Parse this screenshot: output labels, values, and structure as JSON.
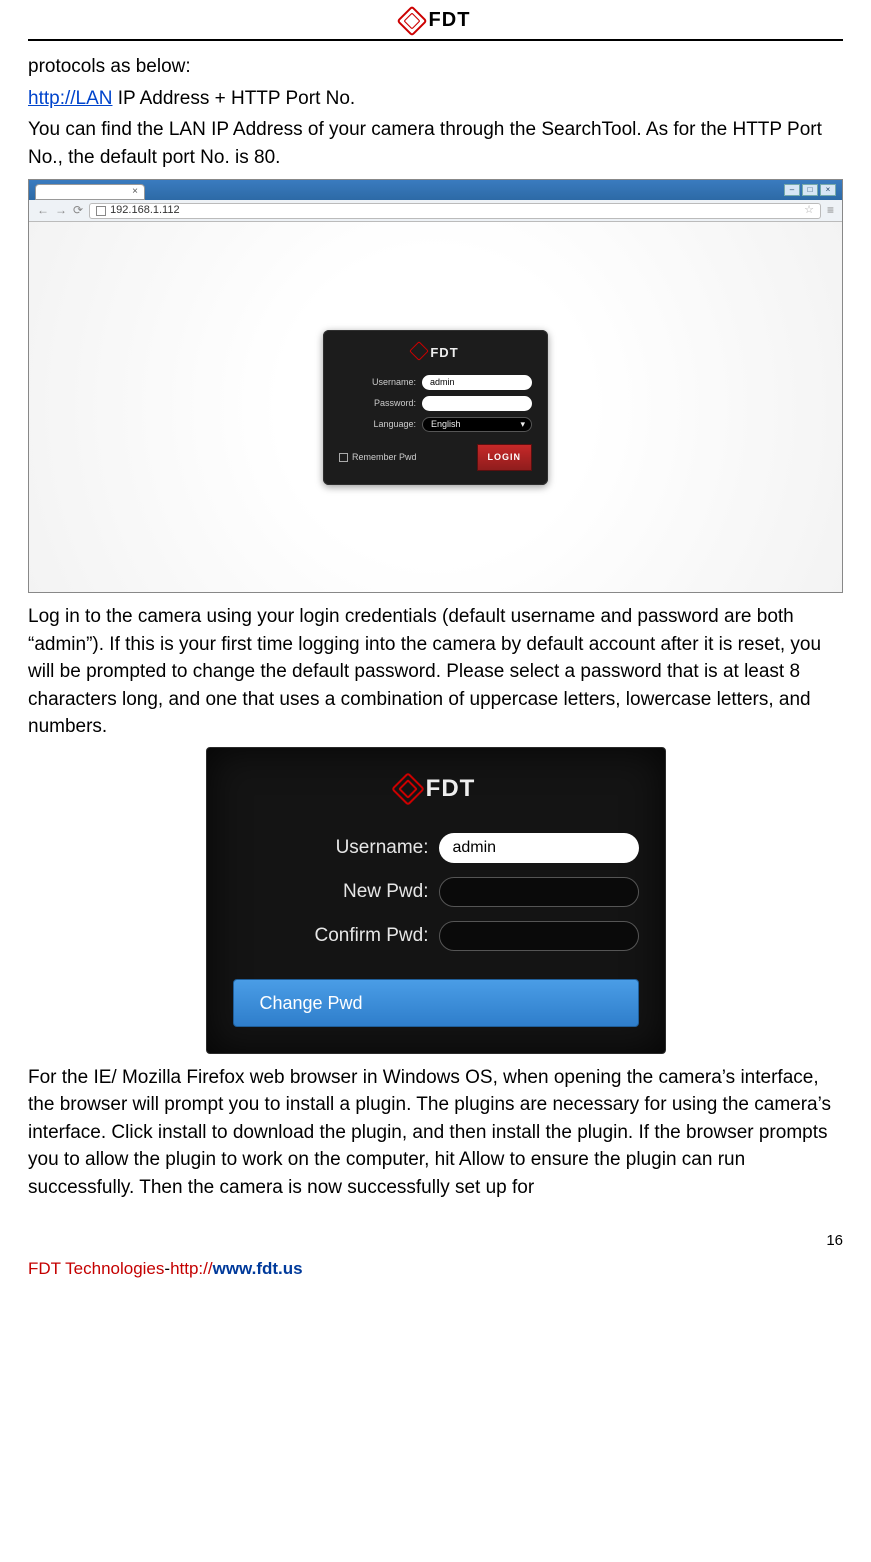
{
  "header": {
    "brand": "FDT"
  },
  "body": {
    "p1": "protocols as below:",
    "link1": "http://LAN",
    "p1b": " IP Address + HTTP Port No.",
    "p2": "You can find the LAN IP Address of your camera through the SearchTool. As for the HTTP Port No., the default port No. is 80.",
    "p3": "Log in to the camera using your login credentials (default username and password are both “admin”). If this is your first time logging into the camera by default account after it is reset, you will be prompted to change the default password. Please select a password that is at least 8 characters long, and one that uses a combination of uppercase letters, lowercase letters, and numbers.",
    "p4": "For the IE/ Mozilla Firefox web browser in Windows OS, when opening the camera’s interface, the browser will prompt you to install a plugin. The plugins are necessary for using the camera’s interface. Click install to download the plugin, and then install the plugin. If the browser prompts you to allow the plugin to work on the computer, hit Allow to ensure the plugin can run successfully. Then the camera is now successfully set up for"
  },
  "browser": {
    "url": "192.168.1.112",
    "tab_close": "×",
    "back": "←",
    "fwd": "→",
    "reload": "⟳",
    "star": "☆",
    "menu": "≡"
  },
  "login": {
    "brand": "FDT",
    "username_label": "Username:",
    "username_value": "admin",
    "password_label": "Password:",
    "language_label": "Language:",
    "language_value": "English",
    "remember": "Remember Pwd",
    "login_btn": "LOGIN"
  },
  "changepwd": {
    "brand": "FDT",
    "username_label": "Username:",
    "username_value": "admin",
    "newpwd_label": "New Pwd:",
    "confirm_label": "Confirm Pwd:",
    "button": "Change Pwd"
  },
  "footer": {
    "page_no": "16",
    "company": "FDT Technologies",
    "dash": "-",
    "url_http": "http://",
    "url_rest": "www.fdt.us"
  }
}
